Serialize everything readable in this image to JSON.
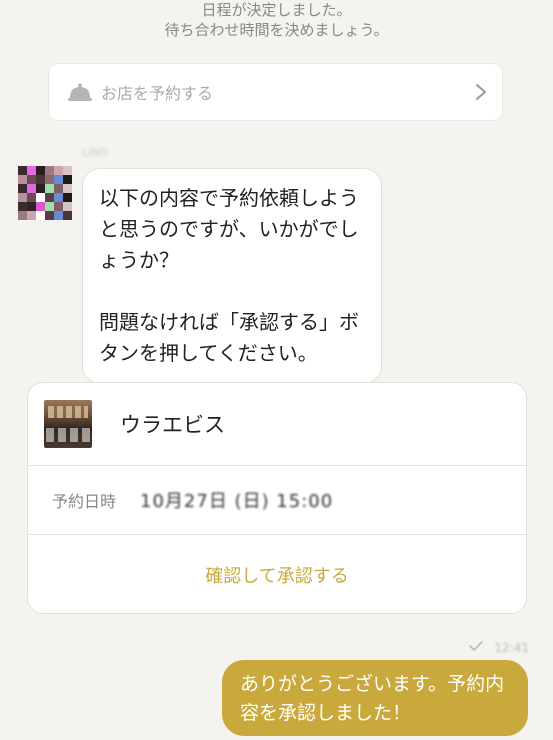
{
  "system_message": {
    "line1": "日程が決定しました。",
    "line2": "待ち合わせ時間を決めましょう。"
  },
  "reserve_bar": {
    "icon": "bell-icon",
    "label": "お店を予約する",
    "chevron": "chevron-right-icon"
  },
  "incoming_message": {
    "sender": "LINO",
    "text": "以下の内容で予約依頼しようと思うのですが、いかがでしょうか？\n\n問題なければ「承認する」ボタンを押してください。"
  },
  "reservation_card": {
    "shop_name": "ウラエビス",
    "date_label": "予約日時",
    "date_value": "10月27日 (日) 15:00",
    "action_label": "確認して承認する"
  },
  "outgoing_message": {
    "status": "既読",
    "time": "12:41",
    "text": "ありがとうございます。予約内容を承認しました！"
  },
  "colors": {
    "accent": "#c9a93b",
    "background": "#f5f3ef",
    "card": "#ffffff"
  }
}
